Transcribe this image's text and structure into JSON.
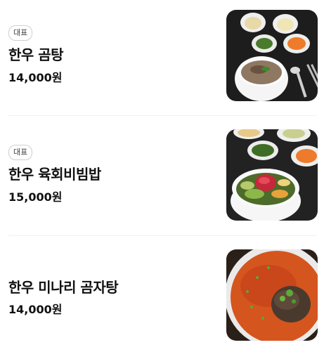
{
  "menu": {
    "items": [
      {
        "badge": "대표",
        "name": "한우 곰탕",
        "price": "14,000원",
        "photo": "gomtang-photo"
      },
      {
        "badge": "대표",
        "name": "한우 육회비빔밥",
        "price": "15,000원",
        "photo": "yukhoe-bibimbap-photo"
      },
      {
        "name": "한우 미나리 곰자탕",
        "price": "14,000원",
        "photo": "minari-gomjatang-photo"
      }
    ]
  }
}
